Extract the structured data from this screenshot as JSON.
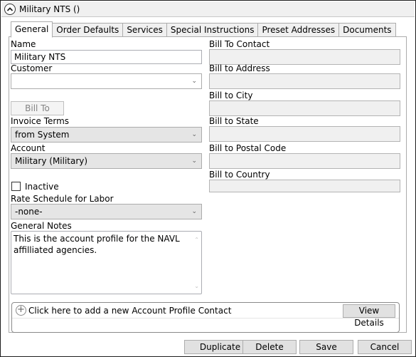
{
  "header": {
    "title": "Military NTS ()"
  },
  "tabs": [
    {
      "label": "General",
      "active": true
    },
    {
      "label": "Order Defaults"
    },
    {
      "label": "Services"
    },
    {
      "label": "Special Instructions"
    },
    {
      "label": "Preset Addresses"
    },
    {
      "label": "Documents"
    }
  ],
  "left": {
    "name_label": "Name",
    "name_value": "Military NTS",
    "customer_label": "Customer",
    "customer_value": "",
    "bill_to_button": "Bill To",
    "invoice_terms_label": "Invoice Terms",
    "invoice_terms_value": "from System",
    "account_label": "Account",
    "account_value": "Military (Military)",
    "inactive_label": "Inactive",
    "inactive_checked": false,
    "rate_schedule_label": "Rate Schedule for Labor",
    "rate_schedule_value": "-none-",
    "notes_label": "General Notes",
    "notes_value": "This is the account profile for the NAVL affilliated agencies."
  },
  "right": {
    "fields": [
      {
        "label": "Bill To Contact",
        "value": ""
      },
      {
        "label": "Bill to Address",
        "value": ""
      },
      {
        "label": "Bill to City",
        "value": ""
      },
      {
        "label": "Bill to State",
        "value": ""
      },
      {
        "label": "Bill to Postal Code",
        "value": ""
      },
      {
        "label": "Bill to Country",
        "value": ""
      }
    ]
  },
  "contacts": {
    "add_text": "Click here to add a new Account Profile Contact",
    "view_details": "View Details"
  },
  "footer": {
    "duplicate": "Duplicate",
    "delete": "Delete",
    "save": "Save",
    "cancel": "Cancel"
  },
  "icons": {
    "collapse": "chevron-up-circle-icon",
    "dropdown": "chevron-down-icon",
    "add": "plus-circle-icon"
  }
}
